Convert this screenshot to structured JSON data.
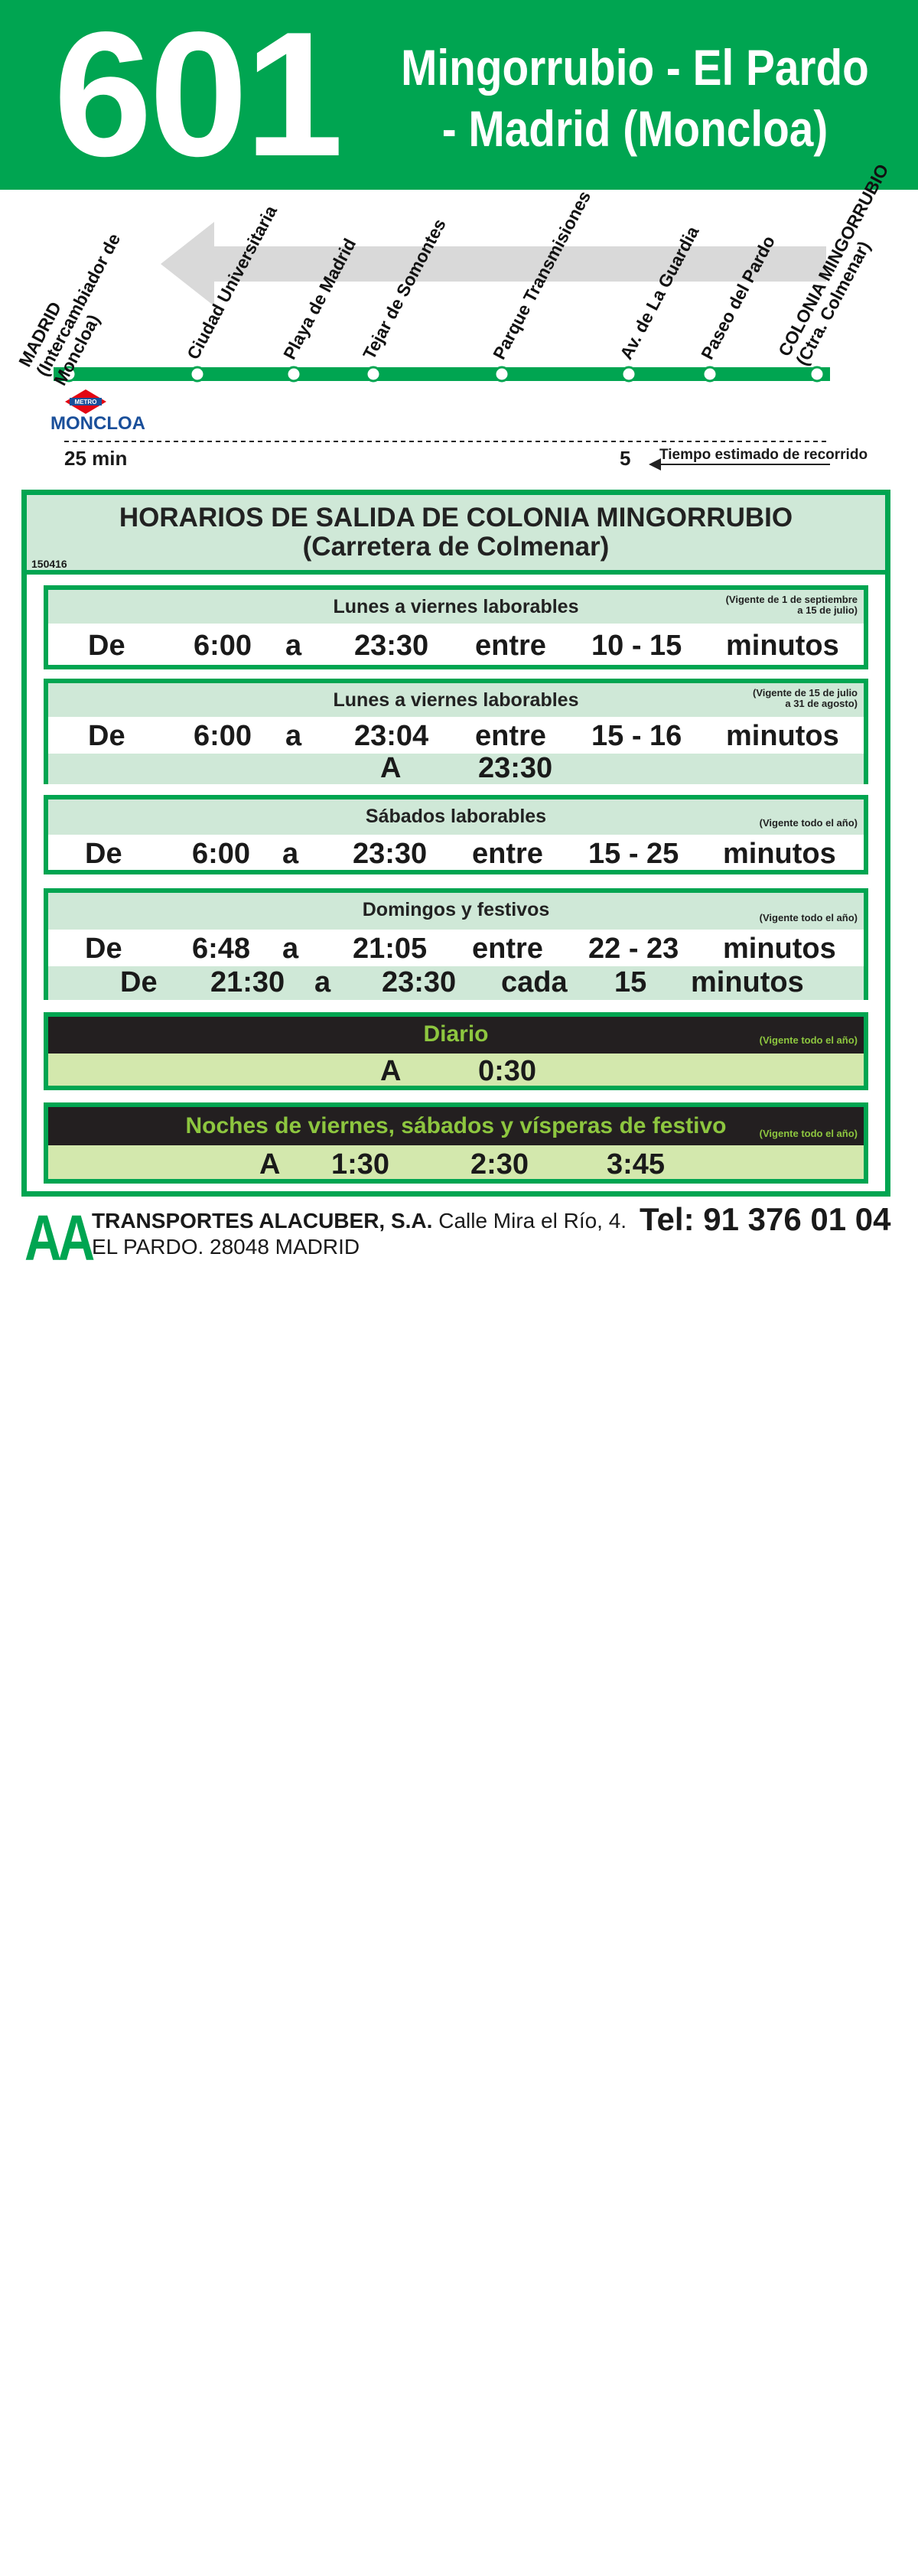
{
  "header": {
    "route_number": "601",
    "route_line1": "Mingorrubio - El Pardo",
    "route_line2": "- Madrid (Moncloa)"
  },
  "stops": [
    {
      "name": "MADRID\n(Intercambiador de\nMoncloa)"
    },
    {
      "name": "Ciudad Universitaria"
    },
    {
      "name": "Playa de Madrid"
    },
    {
      "name": "Tejar de Somontes"
    },
    {
      "name": "Parque Transmisiones"
    },
    {
      "name": "Av. de La Guardia"
    },
    {
      "name": "Paseo del Pardo"
    },
    {
      "name": "COLONIA MINGORRUBIO\n(Ctra. Colmenar)"
    }
  ],
  "metro": {
    "station": "MONCLOA",
    "logo_text": "METRO"
  },
  "travel": {
    "left_time": "25 min",
    "right_time": "5",
    "caption": "Tiempo estimado de recorrido"
  },
  "schedule": {
    "title_line1": "HORARIOS DE SALIDA DE COLONIA MINGORRUBIO",
    "title_line2": "(Carretera de Colmenar)",
    "code": "150416",
    "blocks": [
      {
        "title": "Lunes a viernes laborables",
        "valid": "(Vigente de 1 de septiembre\na 15 de julio)",
        "row1": {
          "de": "De",
          "from": "6:00",
          "a": "a",
          "to": "23:30",
          "entre": "entre",
          "range": "10 - 15",
          "unit": "minutos"
        }
      },
      {
        "title": "Lunes a viernes laborables",
        "valid": "(Vigente de 15 de julio\na 31 de agosto)",
        "row1": {
          "de": "De",
          "from": "6:00",
          "a": "a",
          "to": "23:04",
          "entre": "entre",
          "range": "15 - 16",
          "unit": "minutos"
        },
        "row2": {
          "a": "A",
          "time": "23:30"
        }
      },
      {
        "title": "Sábados laborables",
        "valid": "(Vigente todo el año)",
        "row1": {
          "de": "De",
          "from": "6:00",
          "a": "a",
          "to": "23:30",
          "entre": "entre",
          "range": "15 - 25",
          "unit": "minutos"
        }
      },
      {
        "title": "Domingos y festivos",
        "valid": "(Vigente todo el año)",
        "row1": {
          "de": "De",
          "from": "6:48",
          "a": "a",
          "to": "21:05",
          "entre": "entre",
          "range": "22 - 23",
          "unit": "minutos"
        },
        "row2": {
          "de": "De",
          "from": "21:30",
          "a": "a",
          "to": "23:30",
          "cada": "cada",
          "every": "15",
          "unit": "minutos"
        }
      },
      {
        "title": "Diario",
        "valid": "(Vigente todo el año)",
        "row1": {
          "a": "A",
          "time": "0:30"
        }
      },
      {
        "title": "Noches de viernes, sábados y vísperas de festivo",
        "valid": "(Vigente todo el año)",
        "row1": {
          "a": "A",
          "t1": "1:30",
          "t2": "2:30",
          "t3": "3:45"
        }
      }
    ]
  },
  "company": {
    "logo": "AA",
    "name": "TRANSPORTES ALACUBER, S.A.",
    "address1": " Calle Mira el Río, 4.",
    "address2": "EL PARDO. 28048 MADRID",
    "tel": "Tel: 91 376 01 04"
  },
  "colors": {
    "brand_green": "#00a551",
    "light_green": "#cfe8d7",
    "lime": "#8dc63f",
    "pale_lime": "#d3e8ad",
    "dark": "#231f20",
    "metro_blue": "#1a4f9a"
  }
}
